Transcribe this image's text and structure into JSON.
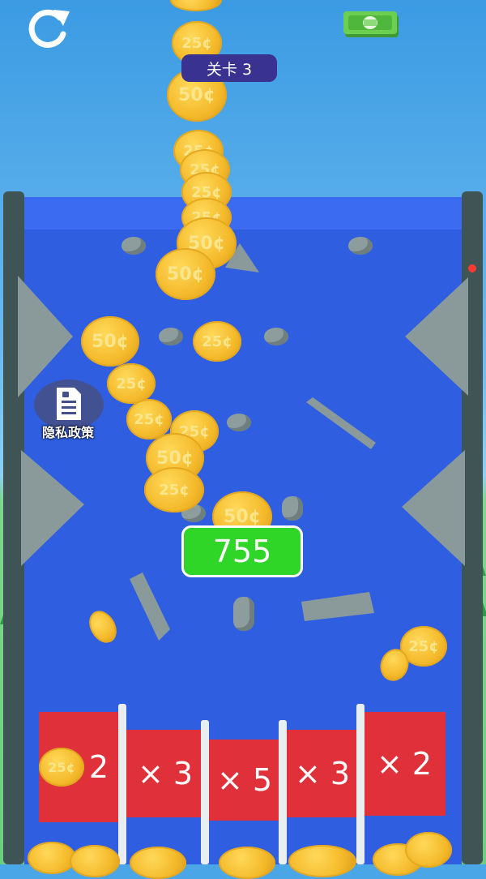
{
  "hud": {
    "level_label": "关卡 3",
    "score": "755",
    "privacy_label": "隐私政策",
    "restart_icon": "restart-icon",
    "money_icon": "cash-icon",
    "privacy_icon": "document-lock-icon"
  },
  "slots": [
    {
      "label": "× 2"
    },
    {
      "label": "× 3"
    },
    {
      "label": "× 5"
    },
    {
      "label": "× 3"
    },
    {
      "label": "× 2"
    }
  ],
  "coins": [
    {
      "text": "25¢"
    },
    {
      "text": "50¢"
    },
    {
      "text": "25¢"
    },
    {
      "text": "25¢"
    },
    {
      "text": "25¢"
    },
    {
      "text": "25¢"
    },
    {
      "text": "50¢"
    },
    {
      "text": "50¢"
    },
    {
      "text": "50¢"
    },
    {
      "text": "25¢"
    },
    {
      "text": "25¢"
    },
    {
      "text": "25¢"
    },
    {
      "text": "25¢"
    },
    {
      "text": "50¢"
    },
    {
      "text": "25¢"
    },
    {
      "text": "50¢"
    },
    {
      "text": "25¢"
    },
    {
      "text": "25¢"
    }
  ],
  "colors": {
    "board": "#2f5fe0",
    "slot": "#e0303a",
    "score_bg": "#2fd628",
    "level_bg": "#3a3290",
    "coin": "#f4b92a"
  }
}
